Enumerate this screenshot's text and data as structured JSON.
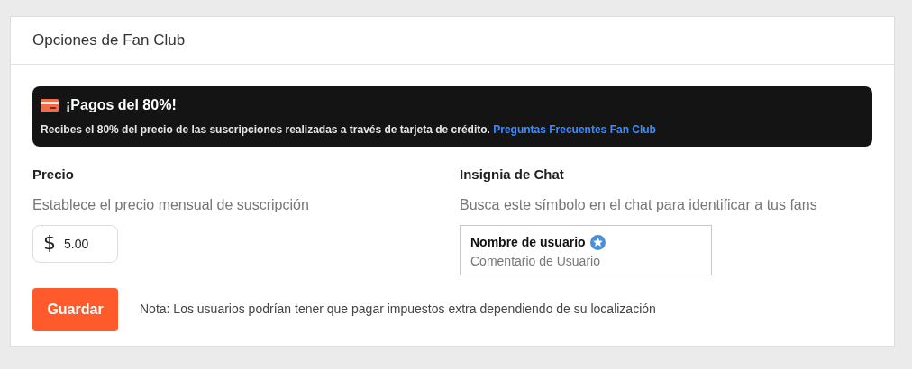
{
  "card": {
    "title": "Opciones de Fan Club"
  },
  "banner": {
    "title": "¡Pagos del 80%!",
    "text": "Recibes el 80% del precio de las suscripciones realizadas a través de tarjeta de crédito.",
    "link": "Preguntas Frecuentes Fan Club"
  },
  "price": {
    "heading": "Precio",
    "description": "Establece el precio mensual de suscripción",
    "currency": "$",
    "value": "5.00"
  },
  "badge": {
    "heading": "Insignia de Chat",
    "description": "Busca este símbolo en el chat para identificar a tus fans",
    "username": "Nombre de usuario",
    "comment": "Comentario de Usuario"
  },
  "save_button": "Guardar",
  "note": "Nota: Los usuarios podrían tener que pagar impuestos extra dependiendo de su localización"
}
